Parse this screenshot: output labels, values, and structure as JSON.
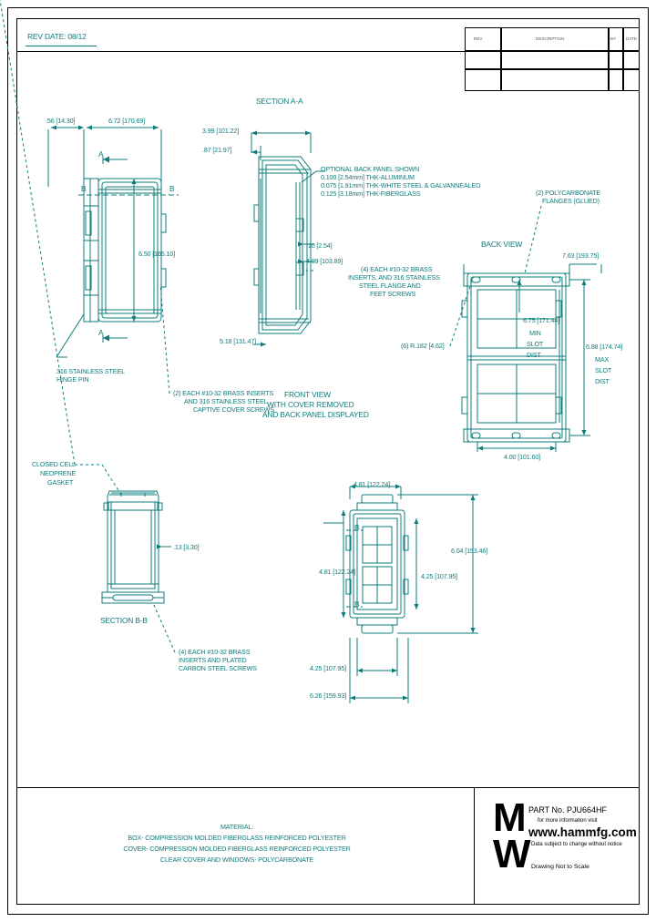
{
  "sheet": {
    "rev_date": "REV DATE: 08/12"
  },
  "title_block": {
    "col_rev": "REV",
    "col_desc": "DESCRIPTION",
    "col_by": "BY",
    "col_date": "DATE"
  },
  "views": {
    "section_aa": "SECTION A-A",
    "section_bb": "SECTION B-B",
    "back_view": "BACK VIEW",
    "front_view_l1": "FRONT VIEW",
    "front_view_l2": "WITH COVER REMOVED",
    "front_view_l3": "AND BACK PANEL DISPLAYED"
  },
  "dimensions": {
    "side_depth": ".56 [14.30]",
    "side_width": "6.72 [170.69]",
    "side_height": "6.50 [165.10]",
    "sec_aa_width": "3.99 [101.22]",
    "sec_aa_flange": ".87 [21.97]",
    "sec_aa_small": ".10 [2.54]",
    "sec_aa_inner_h": "4.09 [103.89]",
    "sec_aa_bottom": "5.18 [131.47]",
    "back_width": "7.63 [193.75]",
    "back_min_slot": "6.75 [171.44]",
    "back_min_slot_l1": "MIN",
    "back_min_slot_l2": "SLOT",
    "back_min_slot_l3": "DIST",
    "back_max_slot": "6.88 [174.74]",
    "back_max_slot_l1": "MAX",
    "back_max_slot_l2": "SLOT",
    "back_max_slot_l3": "DIST",
    "back_slot_size": "(6) R.182 [4.62]",
    "back_bottom": "4.00 [101.60]",
    "gasket_thk": ".13 [3.30]",
    "front_top_w": "4.81 [122.24]",
    "front_left_h": "4.81 [122.24]",
    "front_inner_h": "4.25 [107.95]",
    "front_right_h": "6.04 [153.46]",
    "front_bot_1": "4.25 [107.95]",
    "front_bot_2": "6.26 [159.93]"
  },
  "callouts": {
    "back_panel_title": "OPTIONAL BACK PANEL SHOWN",
    "back_panel_l1": "0.100 [2.54mm] THK-ALUMINUM",
    "back_panel_l2": "0.075 [1.91mm] THK-WHITE STEEL & GALVANNEALED",
    "back_panel_l3": "0.125 [3.18mm] THK-FIBERGLASS",
    "polycarb_l1": "(2) POLYCARBONATE",
    "polycarb_l2": "FLANGES (GLUED)",
    "hinge_l1": "316 STAINLESS STEEL",
    "hinge_l2": "HINGE PIN",
    "cover_screw_l1": "(2) EACH #10-32 BRASS INSERTS",
    "cover_screw_l2": "AND 316 STAINLESS STEEL",
    "cover_screw_l3": "CAPTIVE COVER SCREWS",
    "flange_screw_l1": "(4) EACH #10-32 BRASS",
    "flange_screw_l2": "INSERTS, AND 316 STAINLESS",
    "flange_screw_l3": "STEEL FLANGE AND",
    "flange_screw_l4": "FEET SCREWS",
    "gasket_l1": "CLOSED CELL",
    "gasket_l2": "NEOPRENE",
    "gasket_l3": "GASKET",
    "carbon_screw_l1": "(4) EACH #10-32 BRASS",
    "carbon_screw_l2": "INSERTS AND PLATED",
    "carbon_screw_l3": "CARBON STEEL SCREWS"
  },
  "section_marks": {
    "a_top": "A",
    "a_bottom": "A",
    "b_left": "B",
    "b_right": "B",
    "b_front_left": "B",
    "b_front_right": "B"
  },
  "material": {
    "title": "MATERIAL:",
    "line1": "BOX- COMPRESSION MOLDED FIBERGLASS REINFORCED POLYESTER",
    "line2": "COVER- COMPRESSION MOLDED FIBERGLASS REINFORCED POLYESTER",
    "line3": "CLEAR COVER AND WINDOWS- POLYCARBONATE"
  },
  "brand": {
    "logo_m": "M",
    "logo_w": "W",
    "part_no": "PART No. PJU664HF",
    "info": "for more information visit",
    "website": "www.hammfg.com",
    "disclaimer": "Data subject to change without notice",
    "scale_note": "Drawing Not to Scale"
  }
}
